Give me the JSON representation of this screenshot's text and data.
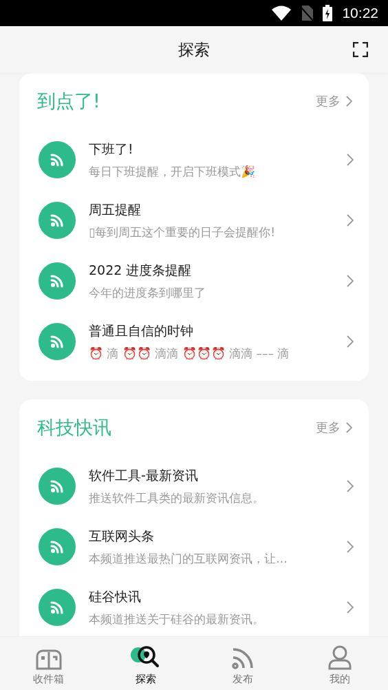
{
  "status_bar": {
    "time": "10:22"
  },
  "header": {
    "title": "探索"
  },
  "sections": [
    {
      "title": "到点了!",
      "more": "更多",
      "items": [
        {
          "title": "下班了!",
          "subtitle": "每日下班提醒，开启下班模式🎉"
        },
        {
          "title": "周五提醒",
          "subtitle": "▯每到周五这个重要的日子会提醒你!"
        },
        {
          "title": "2022 进度条提醒",
          "subtitle": "今年的进度条到哪里了"
        },
        {
          "title": "普通且自信的时钟",
          "subtitle": "⏰ 滴 ⏰⏰ 滴滴 ⏰⏰⏰ 滴滴 ––– 滴"
        }
      ]
    },
    {
      "title": "科技快讯",
      "more": "更多",
      "items": [
        {
          "title": "软件工具-最新资讯",
          "subtitle": "推送软件工具类的最新资讯信息。"
        },
        {
          "title": "互联网头条",
          "subtitle": "本频道推送最热门的互联网资讯，让…"
        },
        {
          "title": "硅谷快讯",
          "subtitle": "本频道推送关于硅谷的最新资讯。"
        }
      ]
    }
  ],
  "nav": [
    {
      "label": "收件箱",
      "kind": "inbox",
      "selected": false
    },
    {
      "label": "探索",
      "kind": "explore",
      "selected": true
    },
    {
      "label": "发布",
      "kind": "publish",
      "selected": false
    },
    {
      "label": "我的",
      "kind": "profile",
      "selected": false
    }
  ]
}
